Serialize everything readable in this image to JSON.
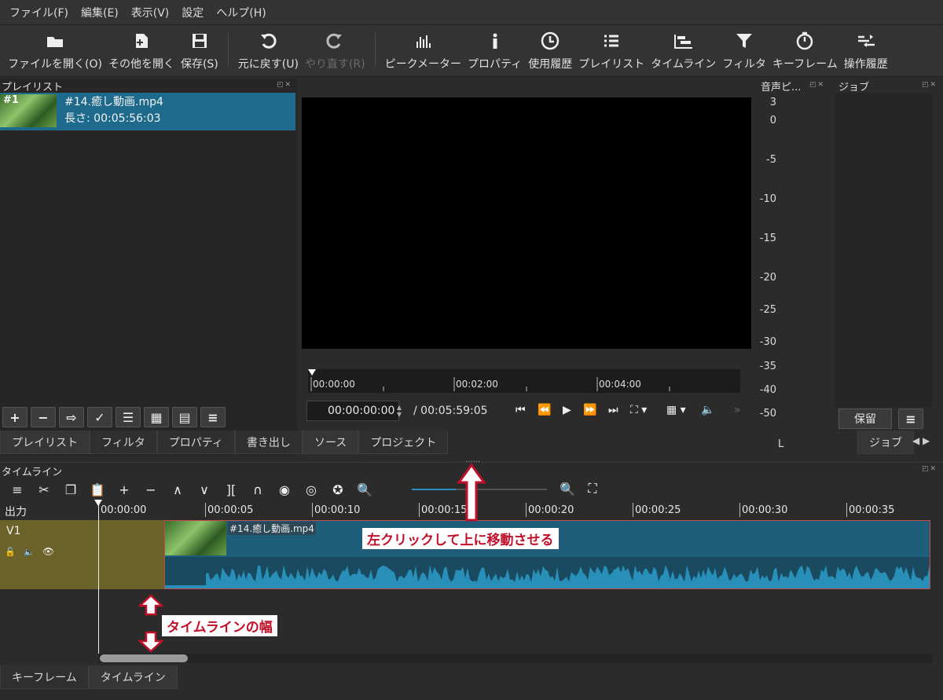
{
  "menu": [
    "ファイル(F)",
    "編集(E)",
    "表示(V)",
    "設定",
    "ヘルプ(H)"
  ],
  "toolbar": {
    "open": "ファイルを開く(O)",
    "open_other": "その他を開く",
    "save": "保存(S)",
    "undo": "元に戻す(U)",
    "redo": "やり直す(R)",
    "peak_meter": "ピークメーター",
    "properties": "プロパティ",
    "history": "使用履歴",
    "playlist": "プレイリスト",
    "timeline": "タイムライン",
    "filters": "フィルタ",
    "keyframes": "キーフレーム",
    "op_history": "操作履歴"
  },
  "playlist": {
    "title": "プレイリスト",
    "item": {
      "index": "#1",
      "name": "#14.癒し動画.mp4",
      "length": "長さ: 00:05:56:03"
    }
  },
  "left_tabs": [
    "プレイリスト",
    "フィルタ",
    "プロパティ",
    "書き出し"
  ],
  "viewer": {
    "ruler_labels": [
      "00:00:00",
      "00:02:00",
      "00:04:00"
    ],
    "timecode": "00:00:00:00",
    "duration": "/ 00:05:59:05",
    "tabs": [
      "ソース",
      "プロジェクト"
    ]
  },
  "meter": {
    "title": "音声ピ...",
    "scale": [
      "3",
      "0",
      "-5",
      "-10",
      "-15",
      "-20",
      "-25",
      "-30",
      "-35",
      "-40",
      "-50"
    ],
    "channel": "L"
  },
  "jobs": {
    "title": "ジョブ",
    "hold_button": "保留",
    "tab": "ジョブ"
  },
  "timeline": {
    "title": "タイムライン",
    "output_label": "出力",
    "track": "V1",
    "ruler": [
      "00:00:00",
      "00:00:05",
      "00:00:10",
      "00:00:15",
      "00:00:20",
      "00:00:25",
      "00:00:30",
      "00:00:35"
    ],
    "clip_name": "#14.癒し動画.mp4"
  },
  "bottom_tabs": [
    "キーフレーム",
    "タイムライン"
  ],
  "annotations": {
    "drag_up": "左クリックして上に移動させる",
    "timeline_width": "タイムラインの幅"
  },
  "colors": {
    "accent": "#2a8fbf",
    "selection": "#1e6a8c",
    "track": "#6a6228",
    "annotation": "#c0102a"
  }
}
